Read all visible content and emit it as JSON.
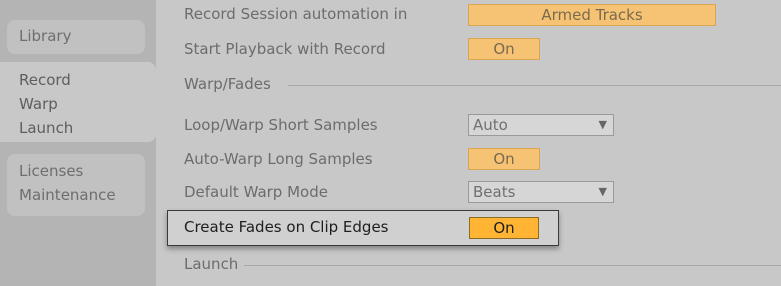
{
  "sidebar": {
    "group1": [
      "Library"
    ],
    "group2": [
      "Record",
      "Warp",
      "Launch"
    ],
    "group3": [
      "Licenses",
      "Maintenance"
    ]
  },
  "settings": {
    "record_automation": {
      "label": "Record Session automation in",
      "value": "Armed Tracks"
    },
    "start_playback": {
      "label": "Start Playback with Record",
      "value": "On"
    },
    "warp_section": "Warp/Fades",
    "loop_warp": {
      "label": "Loop/Warp Short Samples",
      "value": "Auto"
    },
    "auto_warp": {
      "label": "Auto-Warp Long Samples",
      "value": "On"
    },
    "default_warp": {
      "label": "Default Warp Mode",
      "value": "Beats"
    },
    "create_fades": {
      "label": "Create Fades on Clip Edges",
      "value": "On"
    },
    "launch_section": "Launch"
  },
  "icons": {
    "dropdown": "chevron-down-icon"
  },
  "colors": {
    "toggle_on": "#f5c373",
    "toggle_highlight": "#ffb433"
  }
}
